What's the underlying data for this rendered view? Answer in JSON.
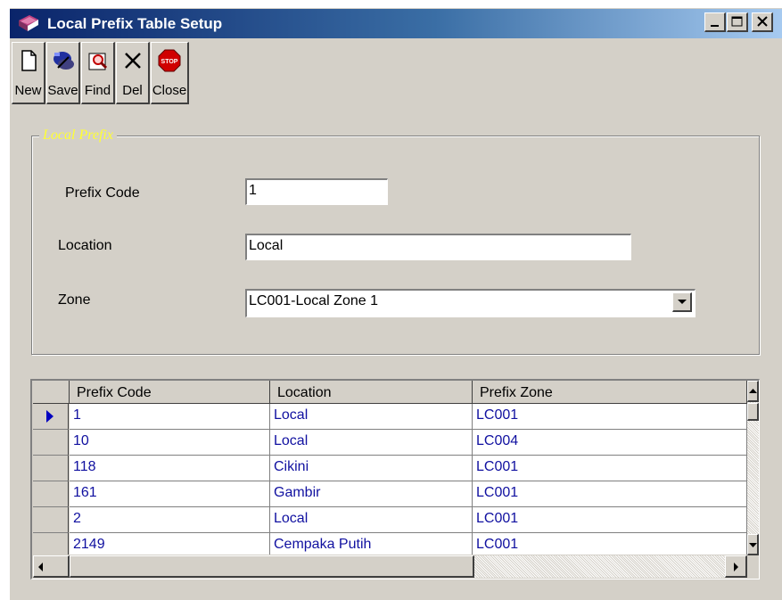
{
  "window": {
    "title": "Local Prefix Table Setup",
    "minimize_glyph": "_",
    "maximize_glyph": "□",
    "close_glyph": "×"
  },
  "toolbar": [
    {
      "id": "new",
      "label": "New",
      "icon": "new-document-icon"
    },
    {
      "id": "save",
      "label": "Save",
      "icon": "save-icon"
    },
    {
      "id": "find",
      "label": "Find",
      "icon": "find-icon"
    },
    {
      "id": "del",
      "label": "Del",
      "icon": "delete-icon"
    },
    {
      "id": "close",
      "label": "Close",
      "icon": "stop-sign-icon",
      "icon_text": "STOP"
    }
  ],
  "form": {
    "group_title": "Local Prefix",
    "prefix_code": {
      "label": "Prefix Code",
      "value": "1"
    },
    "location": {
      "label": "Location",
      "value": "Local"
    },
    "zone": {
      "label": "Zone",
      "value": "LC001-Local Zone 1"
    }
  },
  "grid": {
    "columns": [
      "Prefix Code",
      "Location",
      "Prefix Zone"
    ],
    "rows": [
      [
        "1",
        "Local",
        "LC001"
      ],
      [
        "10",
        "Local",
        "LC004"
      ],
      [
        "118",
        "Cikini",
        "LC001"
      ],
      [
        "161",
        "Gambir",
        "LC001"
      ],
      [
        "2",
        "Local",
        "LC001"
      ],
      [
        "2149",
        "Cempaka Putih",
        "LC001"
      ]
    ],
    "selected_row": 0
  },
  "colors": {
    "title_gradient_start": "#0a246a",
    "title_gradient_end": "#a6caf0",
    "window_bg": "#d4d0c8",
    "legend_text": "#ffff33",
    "grid_text": "#1010a0"
  }
}
